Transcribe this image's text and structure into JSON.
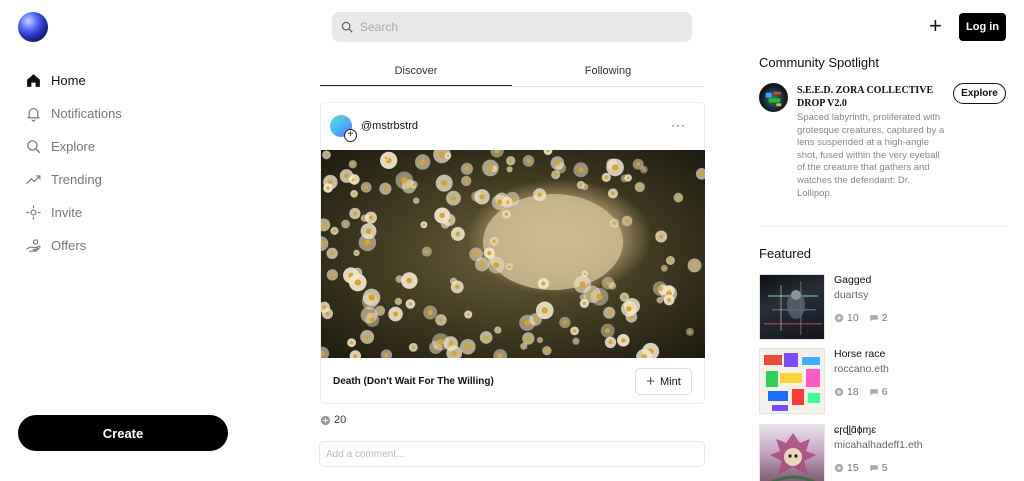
{
  "brand": {
    "logo_icon": "sphere-logo-icon"
  },
  "search": {
    "placeholder": "Search"
  },
  "nav": {
    "items": [
      {
        "label": "Home",
        "icon": "home-icon"
      },
      {
        "label": "Notifications",
        "icon": "bell-icon"
      },
      {
        "label": "Explore",
        "icon": "search-icon"
      },
      {
        "label": "Trending",
        "icon": "trending-icon"
      },
      {
        "label": "Invite",
        "icon": "invite-icon"
      },
      {
        "label": "Offers",
        "icon": "offers-icon"
      }
    ],
    "create_label": "Create"
  },
  "tabs": [
    {
      "label": "Discover"
    },
    {
      "label": "Following"
    }
  ],
  "post": {
    "username": "@mstrbstrd",
    "more": "···",
    "title": "Death (Don't Wait For The Willing)",
    "mint_label": "Mint",
    "likes": "20",
    "comment_placeholder": "Add a comment..."
  },
  "header": {
    "login_label": "Log in",
    "add_label": "+"
  },
  "spotlight": {
    "heading": "Community Spotlight",
    "title": "S.E.E.D. ZORA COLLECTIVE DROP V2.0",
    "description": "Spaced labyrinth, proliferated with grotesque creatures, captured by a lens suspended at a high-angle shot, fused within the very eyeball of the creature that gathers and watches the defendant: Dr. Lollipop.",
    "explore_label": "Explore"
  },
  "featured": {
    "heading": "Featured",
    "items": [
      {
        "title": "Gagged",
        "author": "duartsy",
        "likes": "10",
        "comments": "2"
      },
      {
        "title": "Horse race",
        "author": "roccano.eth",
        "likes": "18",
        "comments": "6"
      },
      {
        "title": "ɕɼɖɭɑ̃ɸɱɛ",
        "author": "micahalhadeff1.eth",
        "likes": "15",
        "comments": "5"
      }
    ]
  },
  "colors": {
    "accent": "#000000",
    "muted": "#888888",
    "search_bg": "#e9e9e9"
  }
}
